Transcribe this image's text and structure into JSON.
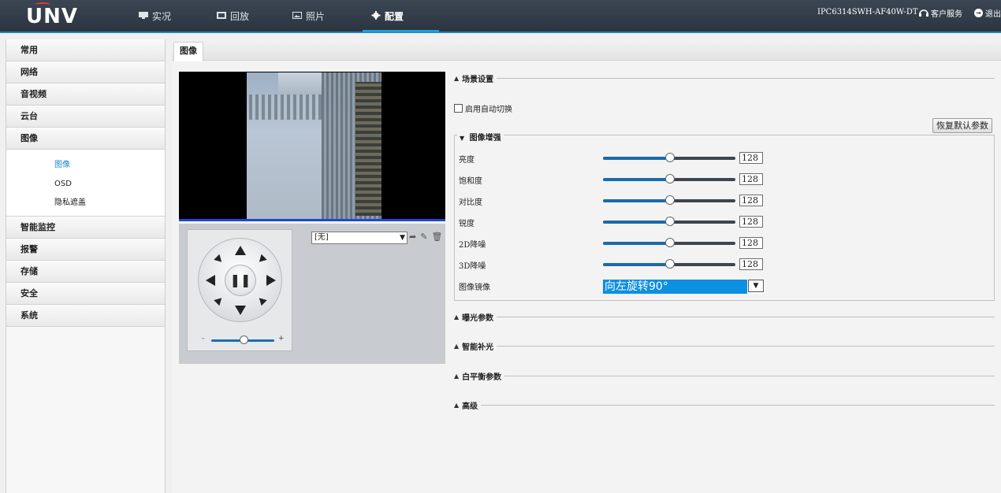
{
  "header": {
    "logo": "UNV",
    "nav": [
      {
        "label": "实况",
        "icon": "monitor-icon"
      },
      {
        "label": "回放",
        "icon": "film-icon"
      },
      {
        "label": "照片",
        "icon": "photo-icon"
      },
      {
        "label": "配置",
        "icon": "gear-icon"
      }
    ],
    "model": "IPC6314SWH-AF40W-DT",
    "customer_service": "客户服务",
    "logout": "退出"
  },
  "sidebar": {
    "items_top": [
      "常用",
      "网络",
      "音视频",
      "云台",
      "图像"
    ],
    "sub_items": [
      "图像",
      "OSD",
      "隐私遮盖"
    ],
    "active_sub": "图像",
    "items_bottom": [
      "智能监控",
      "报警",
      "存储",
      "安全",
      "系统"
    ]
  },
  "tab": {
    "label": "图像"
  },
  "ptz": {
    "preset_value": "[无]",
    "zoom_minus": "-",
    "zoom_plus": "+"
  },
  "settings": {
    "scene_title": "场景设置",
    "auto_switch_label": "启用自动切换",
    "restore_button": "恢复默认参数",
    "enhance_title": "图像增强",
    "params": [
      {
        "label": "亮度",
        "value": "128"
      },
      {
        "label": "饱和度",
        "value": "128"
      },
      {
        "label": "对比度",
        "value": "128"
      },
      {
        "label": "锐度",
        "value": "128"
      },
      {
        "label": "2D降噪",
        "value": "128"
      },
      {
        "label": "3D降噪",
        "value": "128"
      }
    ],
    "mirror_label": "图像镜像",
    "mirror_value": "向左旋转90°",
    "exposure_title": "曝光参数",
    "smart_light_title": "智能补光",
    "wb_title": "白平衡参数",
    "advanced_title": "高级"
  }
}
